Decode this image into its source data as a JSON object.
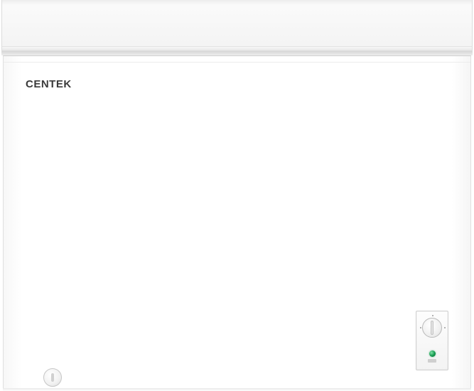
{
  "product": {
    "brand_name": "CENTEK",
    "type": "chest-freezer",
    "color": "#ffffff",
    "indicator_color": "#14994e"
  },
  "controls": {
    "thermostat": {
      "icon": "thermostat-knob-icon"
    },
    "power_indicator": {
      "icon": "green-led-icon",
      "state": "on"
    },
    "lock": {
      "icon": "lock-icon"
    }
  }
}
